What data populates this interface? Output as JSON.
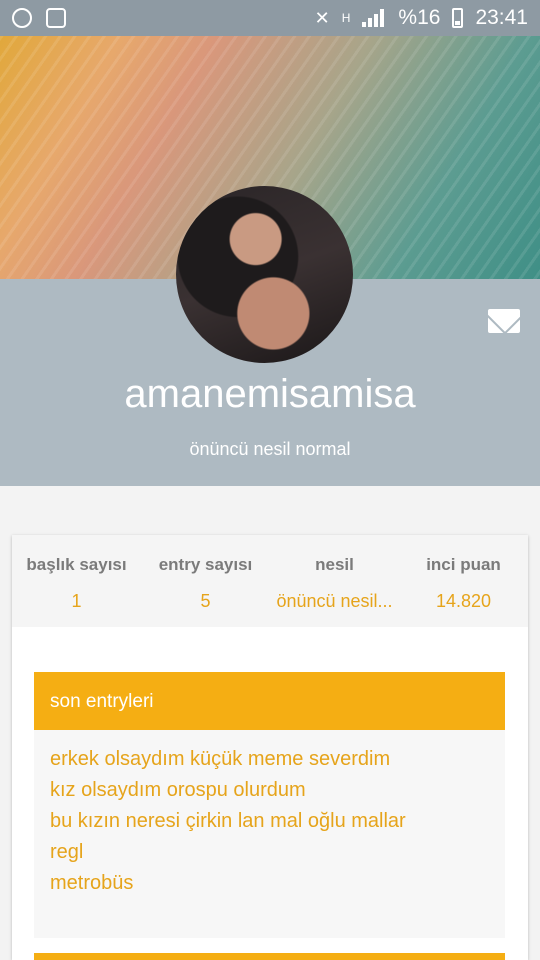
{
  "status_bar": {
    "left_icons": [
      "whatsapp-icon",
      "image-icon"
    ],
    "network": "H",
    "battery": "%16",
    "time": "23:41"
  },
  "profile": {
    "username": "amanemisamisa",
    "title": "önüncü nesil normal",
    "mail_icon": "mail-icon"
  },
  "stats": [
    {
      "label": "başlık sayısı",
      "value": "1"
    },
    {
      "label": "entry sayısı",
      "value": "5"
    },
    {
      "label": "nesil",
      "value": "önüncü nesil..."
    },
    {
      "label": "inci puan",
      "value": "14.820"
    }
  ],
  "recent": {
    "header": "son entryleri",
    "items": [
      "erkek olsaydım küçük meme severdim",
      "kız olsaydım orospu olurdum",
      "bu kızın neresi çirkin lan mal oğlu mallar",
      "regl",
      "metrobüs"
    ]
  },
  "colors": {
    "accent": "#f5ae13",
    "link": "#e6a41b",
    "header_panel": "#aebac2"
  }
}
